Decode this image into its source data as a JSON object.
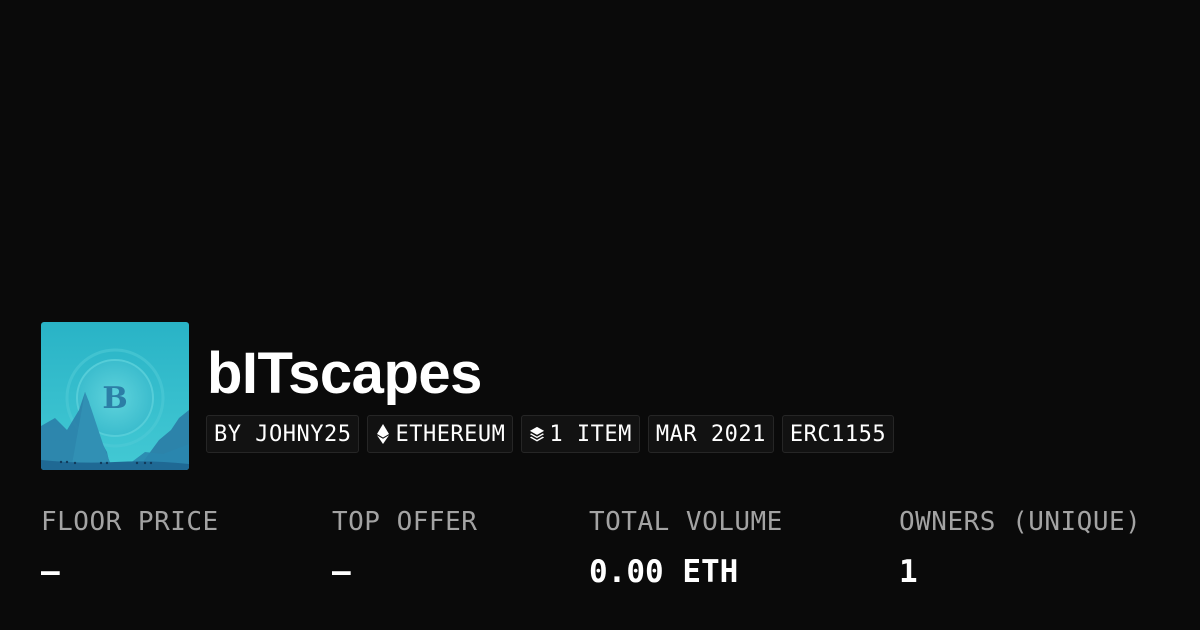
{
  "collection": {
    "name": "bITscapes",
    "avatar_letter": "B",
    "avatar_colors": {
      "sky_top": "#2ab7c9",
      "sky_bottom": "#3ec6d3",
      "mountain": "#2b7fa8",
      "ground": "#1d5f8c",
      "coin_letter": "#2c7ea6"
    }
  },
  "tags": [
    {
      "label": "BY JOHNY25",
      "icon": ""
    },
    {
      "label": "ETHEREUM",
      "icon": "ethereum-icon"
    },
    {
      "label": "1 ITEM",
      "icon": "layers-icon"
    },
    {
      "label": "MAR 2021",
      "icon": ""
    },
    {
      "label": "ERC1155",
      "icon": ""
    }
  ],
  "stats": [
    {
      "label": "FLOOR PRICE",
      "value": "—"
    },
    {
      "label": "TOP OFFER",
      "value": "—"
    },
    {
      "label": "TOTAL VOLUME",
      "value": "0.00 ETH"
    },
    {
      "label": "OWNERS (UNIQUE)",
      "value": "1"
    }
  ],
  "theme": {
    "background": "#0a0a0a",
    "tag_background": "#121212",
    "tag_border": "#262626",
    "label_color": "#a3a3a3",
    "value_color": "#ffffff"
  }
}
